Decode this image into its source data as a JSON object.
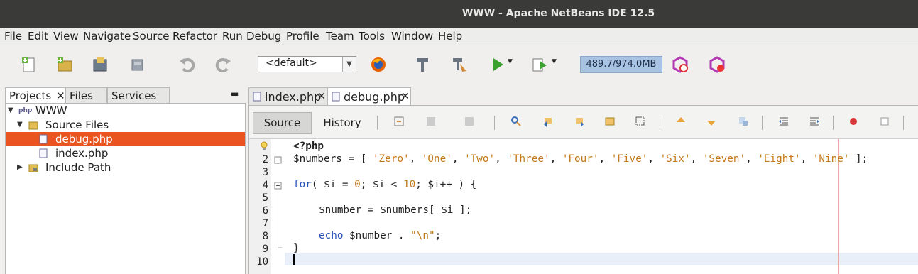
{
  "window": {
    "title": "WWW - Apache NetBeans IDE 12.5"
  },
  "menu": [
    "File",
    "Edit",
    "View",
    "Navigate",
    "Source",
    "Refactor",
    "Run",
    "Debug",
    "Profile",
    "Team",
    "Tools",
    "Window",
    "Help"
  ],
  "toolbar": {
    "config_value": "<default>",
    "memory": "489.7/974.0MB"
  },
  "left_tabs": [
    "Projects",
    "Files",
    "Services"
  ],
  "tree": {
    "project": "WWW",
    "source_files": "Source Files",
    "files": [
      "debug.php",
      "index.php"
    ],
    "include_path": "Include Path"
  },
  "editor_tabs": [
    "index.php",
    "debug.php"
  ],
  "editor_toolbar": {
    "source": "Source",
    "history": "History"
  },
  "line_numbers": [
    "1",
    "2",
    "3",
    "4",
    "5",
    "6",
    "7",
    "8",
    "9",
    "10"
  ],
  "code": {
    "l1": "<?php",
    "l2_var": "$numbers",
    "l2_rest": " = [ ",
    "strs": [
      "'Zero'",
      "'One'",
      "'Two'",
      "'Three'",
      "'Four'",
      "'Five'",
      "'Six'",
      "'Seven'",
      "'Eight'",
      "'Nine'"
    ],
    "l4_kw": "for",
    "l4_a": "( $i = ",
    "l4_n0": "0",
    "l4_b": "; $i < ",
    "l4_n10": "10",
    "l4_c": "; $i++ ) {",
    "l6": "$number = $numbers[ $i ];",
    "l8_kw": "echo",
    "l8_a": " $number . ",
    "l8_str": "\"\\n\"",
    "l8_b": ";",
    "l9": "}"
  },
  "colors": {
    "selection": "#e95420",
    "string": "#c47a1a",
    "keyword": "#2650b8"
  }
}
